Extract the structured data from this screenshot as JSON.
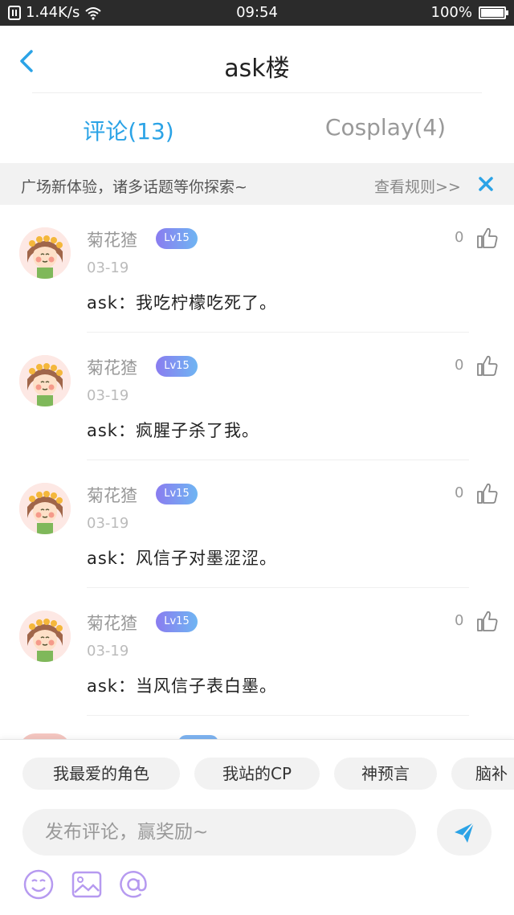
{
  "status_bar": {
    "network_speed": "1.44K/s",
    "time": "09:54",
    "battery": "100%",
    "battery_level": 1.0
  },
  "header": {
    "title": "ask楼",
    "back_icon": "chevron-left-icon"
  },
  "tabs": [
    {
      "label": "评论(13)",
      "active": true
    },
    {
      "label": "Cosplay(4)",
      "active": false
    }
  ],
  "notice": {
    "text": "广场新体验，诸多话题等你探索~",
    "link": "查看规则>>",
    "close_icon": "close-icon"
  },
  "comments": [
    {
      "user": "菊花猹",
      "level": "Lv15",
      "date": "03-19",
      "text": "ask：我吃柠檬吃死了。",
      "likes": "0"
    },
    {
      "user": "菊花猹",
      "level": "Lv15",
      "date": "03-19",
      "text": "ask：疯腥子杀了我。",
      "likes": "0"
    },
    {
      "user": "菊花猹",
      "level": "Lv15",
      "date": "03-19",
      "text": "ask：风信子对墨涩涩。",
      "likes": "0"
    },
    {
      "user": "菊花猹",
      "level": "Lv15",
      "date": "03-19",
      "text": "ask：当风信子表白墨。",
      "likes": "0"
    }
  ],
  "bottom": {
    "topics": [
      "我最爱的角色",
      "我站的CP",
      "神预言",
      "脑补"
    ],
    "input_placeholder": "发布评论，赢奖励~",
    "icons": [
      "emoji-icon",
      "image-icon",
      "at-icon",
      "send-icon"
    ]
  },
  "colors": {
    "accent": "#2ba3e6",
    "badge_start": "#8a7cf0",
    "badge_end": "#6fb5f2",
    "status_bar": "#2b2b2b"
  }
}
